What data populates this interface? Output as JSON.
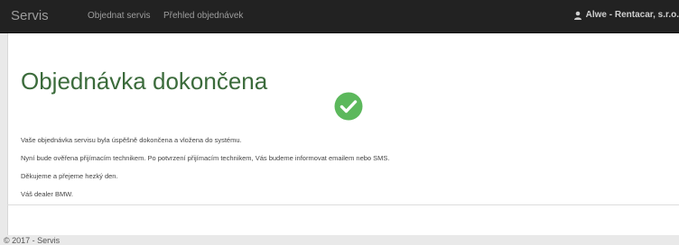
{
  "navbar": {
    "brand": "Servis",
    "links": [
      {
        "label": "Objednat servis"
      },
      {
        "label": "Přehled objednávek"
      }
    ],
    "user": "Alwe - Rentacar, s.r.o.",
    "icon": "user-icon",
    "background_color": "#222222"
  },
  "main": {
    "title": "Objednávka dokončena",
    "status_icon": "check-circle-icon",
    "status_color": "#5cb85c",
    "messages": [
      "Vaše objednávka servisu byla úspěšně dokončena a vložena do systému.",
      "Nyní bude ověřena přijímacím technikem. Po potvrzení přijímacím technikem, Vás budeme informovat emailem nebo SMS.",
      "Děkujeme a přejeme hezký den.",
      "Váš dealer BMW."
    ]
  },
  "footer": {
    "text": "© 2017 - Servis"
  }
}
